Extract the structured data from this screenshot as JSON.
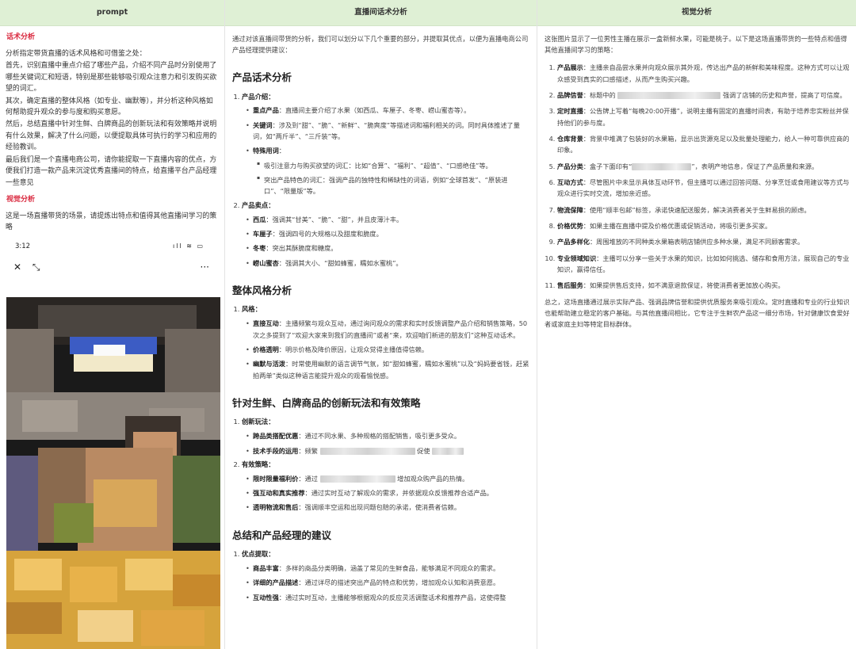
{
  "headers": {
    "col1": "prompt",
    "col2": "直播间话术分析",
    "col3": "视觉分析"
  },
  "prompt": {
    "section1_title": "话术分析",
    "para1": "分析指定带货直播的话术风格和可借鉴之处：",
    "para2": "首先，识别直播中重点介绍了哪些产品，介绍不同产品时分别使用了哪些关键词汇和短语，特别是那些能够吸引观众注意力和引发购买欲望的词汇。",
    "para3": "其次，确定直播的整体风格（如专业、幽默等），并分析这种风格如何帮助提升观众的参与度和购买意愿。",
    "para4": "然后，总结直播中针对生鲜、白牌商品的创新玩法和有效策略并说明有什么效果，解决了什么问题，以便提取具体可执行的学习和应用的经验教训。",
    "para5": "最后我们是一个直播电商公司，请你能提取一下直播内容的优点，方便我们打造一款产品来沉淀优秀直播间的特点，给直播平台产品经理一些意见",
    "section2_title": "视觉分析",
    "para6": "这是一场直播带货的场景，请提炼出特点和值得其他直播间学习的策略",
    "phone_time": "3:12",
    "phone_status_icons": "ıll ≋ ▭",
    "phone_close": "✕",
    "phone_shrink": "⤡",
    "phone_more": "···"
  },
  "analysis": {
    "intro": "通过对该直播间带货的分析，我们可以划分以下几个重要的部分，并提取其优点，以便为直播电商公司产品经理提供建议：",
    "h1": "产品话术分析",
    "p1": "产品介绍：",
    "p1_a_k": "重点产品",
    "p1_a": "：直播间主要介绍了水果（如西瓜、车厘子、冬枣、崂山蜜杏等）。",
    "p1_b_k": "关键词",
    "p1_b": "：涉及到“甜”、“脆”、“新鲜”、“脆爽度”等描述词和福利相关的词。同时具体推述了量词，如“两斤半”、“三斤装”等。",
    "p1_c_k": "特殊用词",
    "p1_c": "：",
    "p1_c1": "吸引注意力与购买欲望的词汇：比如“合算”、“福利”、“超值”、“口感绝佳”等。",
    "p1_c2": "突出产品特色的词汇：强调产品的独特性和稀缺性的词语，例如“全球首发”、“原装进口”、“限量版”等。",
    "p2": "产品卖点：",
    "p2_a_k": "西瓜",
    "p2_a": "：强调其“甘美”、“脆”、“甜”，并且皮薄汁丰。",
    "p2_b_k": "车厘子",
    "p2_b": "：强调四号的大规格以及甜度和脆度。",
    "p2_c_k": "冬枣",
    "p2_c": "：突出其酥脆度和糖度。",
    "p2_d_k": "崂山蜜杏",
    "p2_d": "：强调其大小、“甜如蜂蜜，糯如水蜜桃”。",
    "h2": "整体风格分析",
    "s1": "风格：",
    "s1_a_k": "直接互动",
    "s1_a": "：主播频繁与观众互动，通过询问观众的需求和实时反馈调整产品介绍和销售策略，50次之多提到了“欢迎大家来到我们的直播间”或者“来，欢迎咱们新进的朋友们”这种互动话术。",
    "s1_b_k": "价格透明",
    "s1_b": "：明示价格及降价原因，让观众觉得主播值得信赖。",
    "s1_c_k": "幽默与活泼",
    "s1_c": "：时常使用幽默的语言调节气氛，如“甜如蜂蜜，糯如水蜜桃”以及“妈妈要省钱，赶紧拍两单”类似这种语言能提升观众的观看愉悦感。",
    "h3": "针对生鲜、白牌商品的创新玩法和有效策略",
    "c1": "创新玩法：",
    "c1_a_k": "跨品类搭配优惠",
    "c1_a": "：通过不同水果、多种规格的搭配销售，吸引更多受众。",
    "c1_b_k": "技术手段的运用",
    "c1_b": "：频繁",
    "c1_b2": "促使",
    "c2": "有效策略：",
    "c2_a_k": "限时限量福利价",
    "c2_a": "：通过",
    "c2_a2": "增加观众购产品的热情。",
    "c2_b_k": "强互动和真实推荐",
    "c2_b": "：通过实时互动了解观众的需求，并依据观众反馈推荐合适产品。",
    "c2_c_k": "透明物流和售后",
    "c2_c": "：强调顺丰空运和出现问题包赔的承诺，使消费者信赖。",
    "h4": "总结和产品经理的建议",
    "d1": "优点提取：",
    "d1_a_k": "商品丰富",
    "d1_a": "：多样的商品分类明确，涵盖了常见的生鲜食品，能够满足不同观众的需求。",
    "d1_b_k": "详细的产品描述",
    "d1_b": "：通过详尽的描述突出产品的特点和优势，增加观众认知和消费意愿。",
    "d1_c_k": "互动性强",
    "d1_c": "：通过实时互动，主播能够根据观众的反应灵活调整话术和推荐产品，这使得整"
  },
  "visual": {
    "intro": "这张图片显示了一位男性主播在展示一盒新鲜水果，可能是桃子。以下是这场直播带货的一些特点和值得其他直播间学习的策略：",
    "items": [
      {
        "k": "产品展示",
        "t": "：主播亲自品尝水果并向观众展示其外观，传达出产品的新鲜和美味程度。这种方式可以让观众感受到真实的口感描述，从而产生购买兴趣。"
      },
      {
        "k": "品牌信誉",
        "t": "：标题中的",
        "t2": "强调了店铺的历史和声誉，提高了可信度。"
      },
      {
        "k": "定时直播",
        "t": "：公告牌上写着“每晚20:00开播”，说明主播有固定的直播时间表，有助于培养忠实粉丝并保持他们的参与度。"
      },
      {
        "k": "仓库背景",
        "t": "：背景中堆满了包装好的水果箱，显示出货源充足以及批量处理能力，给人一种可靠供应商的印象。"
      },
      {
        "k": "产品分类",
        "t": "：盒子下面印有“",
        "t2": "”，表明产地信息，保证了产品质量和来源。"
      },
      {
        "k": "互动方式",
        "t": "：尽管图片中未显示具体互动环节，但主播可以通过回答问题、分享烹饪或食用建议等方式与观众进行实时交流，增加亲近感。"
      },
      {
        "k": "物流保障",
        "t": "：使用“顺丰包邮”标签，承诺快速配送服务，解决消费者关于生鲜易损的顾虑。"
      },
      {
        "k": "价格优势",
        "t": "：如果主播在直播中提及价格优惠或促销活动，将吸引更多买家。"
      },
      {
        "k": "产品多样化",
        "t": "：周围堆放的不同种类水果箱表明店铺供应多种水果，满足不同顾客需求。"
      },
      {
        "k": "专业领域知识",
        "t": "：主播可以分享一些关于水果的知识，比如如何挑选、储存和食用方法，展现自己的专业知识，赢得信任。"
      },
      {
        "k": "售后服务",
        "t": "：如果提供售后支持，如不满意退款保证，将使消费者更加放心购买。"
      }
    ],
    "summary": "总之，这场直播通过展示实际产品、强调品牌信誉和提供优质服务来吸引观众。定时直播和专业的行业知识也能帮助建立稳定的客户基础。与其他直播间相比，它专注于生鲜农产品这一细分市场，针对健康饮食爱好者或家庭主妇等特定目标群体。"
  }
}
